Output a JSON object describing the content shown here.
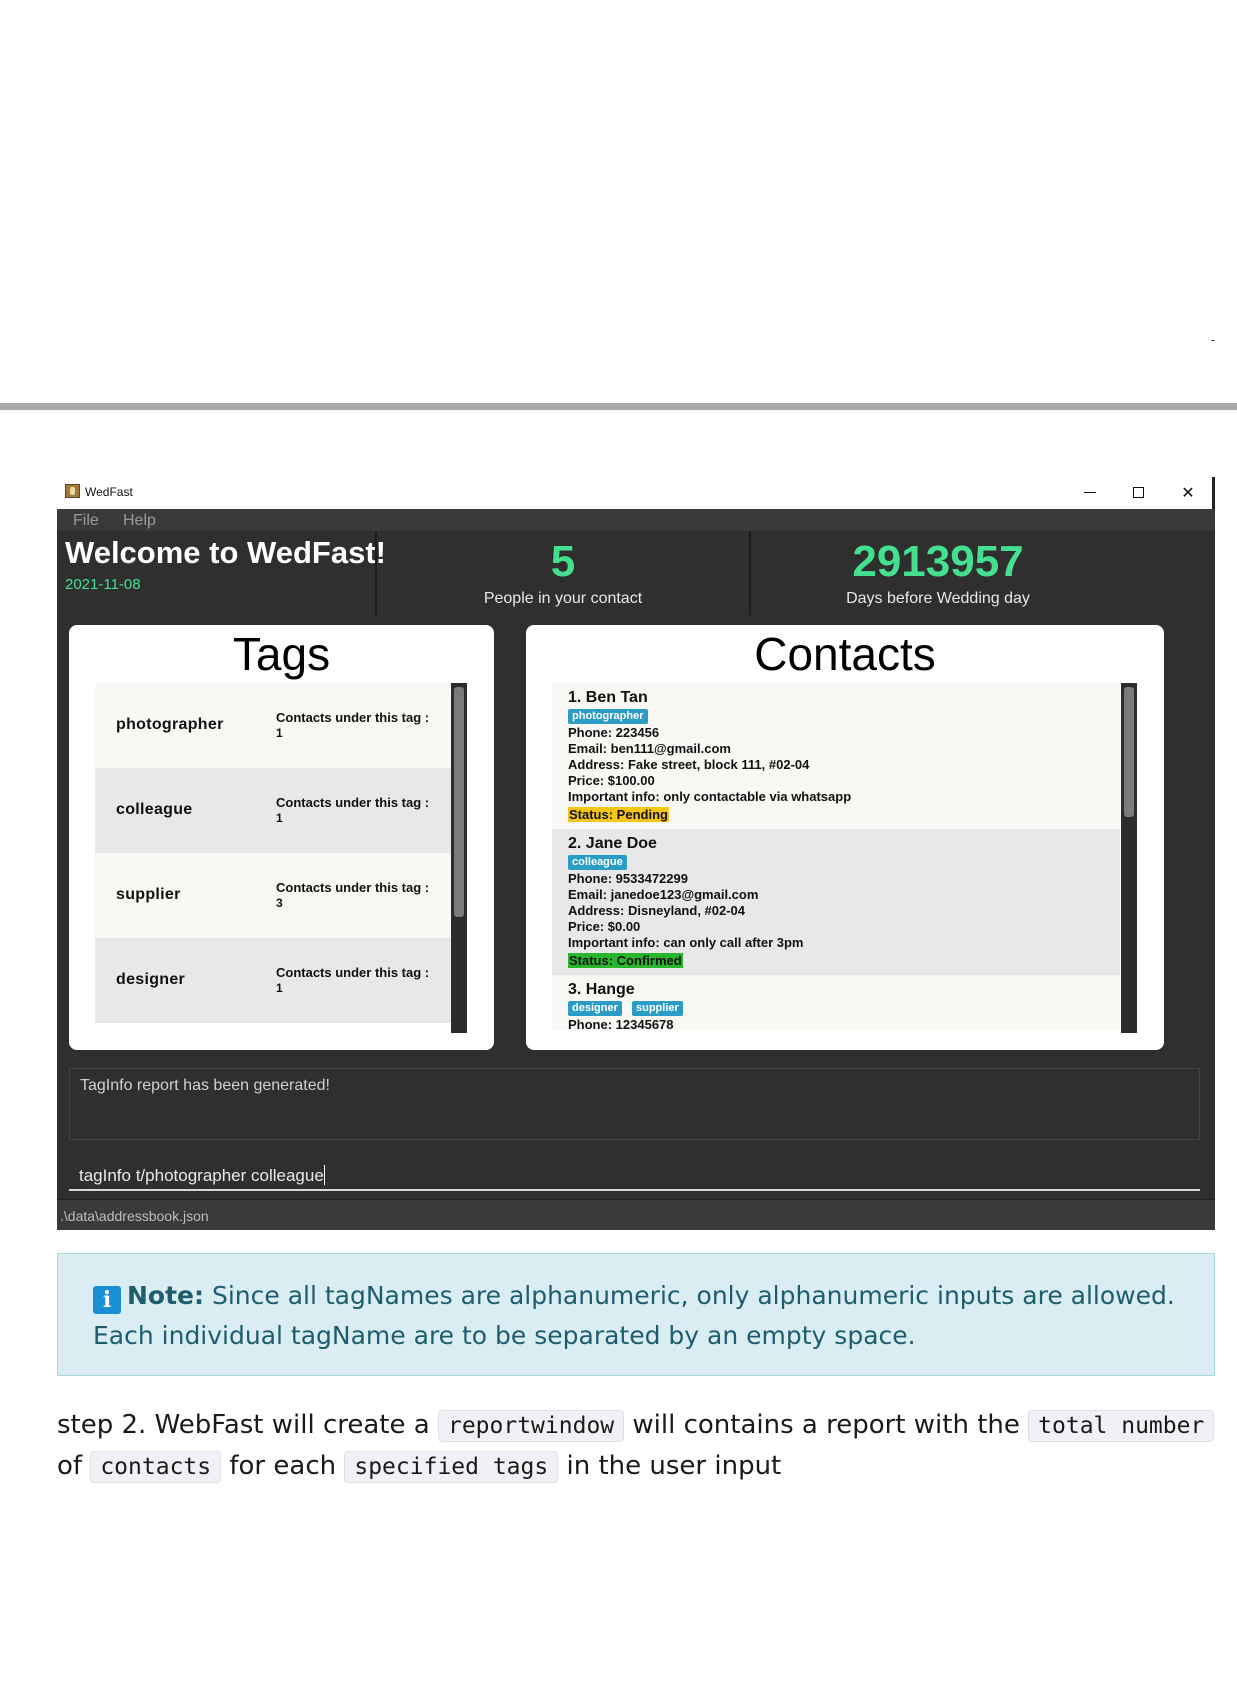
{
  "window": {
    "title": "WedFast",
    "controls": {
      "minimize": "",
      "maximize": "",
      "close": "✕"
    }
  },
  "menu": [
    "File",
    "Help"
  ],
  "header": {
    "welcome": "Welcome to WedFast!",
    "date": "2021-11-08",
    "people_count": "5",
    "people_label": "People in your contact",
    "days_count": "2913957",
    "days_label": "Days before Wedding day",
    "accent_color": "#45e08f"
  },
  "tags_panel": {
    "title": "Tags",
    "items": [
      {
        "name": "photographer",
        "count_label": "Contacts under this tag :",
        "count": "1"
      },
      {
        "name": "colleague",
        "count_label": "Contacts under this tag :",
        "count": "1"
      },
      {
        "name": "supplier",
        "count_label": "Contacts under this tag :",
        "count": "3"
      },
      {
        "name": "designer",
        "count_label": "Contacts under this tag :",
        "count": "1"
      }
    ]
  },
  "contacts_panel": {
    "title": "Contacts",
    "contacts": [
      {
        "name": "1.  Ben Tan",
        "tags": [
          "photographer"
        ],
        "phone": "Phone: 223456",
        "email": "Email: ben111@gmail.com",
        "address": "Address: Fake street, block 111, #02-04",
        "price": "Price: $100.00",
        "info": "Important info: only contactable via whatsapp",
        "status": "Status: Pending",
        "status_color": "#f5c518"
      },
      {
        "name": "2.  Jane Doe",
        "tags": [
          "colleague"
        ],
        "phone": "Phone: 9533472299",
        "email": "Email: janedoe123@gmail.com",
        "address": "Address: Disneyland, #02-04",
        "price": "Price: $0.00",
        "info": "Important info: can only call after 3pm",
        "status": "Status: Confirmed",
        "status_color": "#28b62c"
      },
      {
        "name": "3.  Hange",
        "tags": [
          "designer",
          "supplier"
        ],
        "phone": "Phone: 12345678"
      }
    ]
  },
  "result_display": "TagInfo report has been generated!",
  "command_input": "tagInfo t/photographer colleague",
  "status_bar": ".\\data\\addressbook.json",
  "note": {
    "icon": "info-icon",
    "icon_glyph": "i",
    "label": "Note:",
    "text": " Since all tagNames are alphanumeric, only alphanumeric inputs are allowed. Each individual tagName are to be separated by an empty space."
  },
  "step": {
    "part1": "step 2. WebFast will create a ",
    "code1": "reportwindow",
    "part2": " will contains a report with the ",
    "code2": "total number",
    "part3": " of ",
    "code3": "contacts",
    "part4": " for each ",
    "code4": "specified tags",
    "part5": " in the user input"
  }
}
